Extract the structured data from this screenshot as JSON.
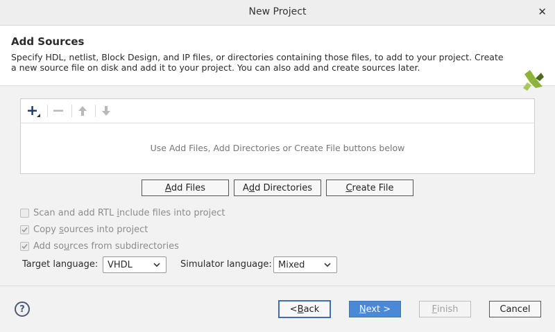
{
  "window": {
    "title": "New Project",
    "close_glyph": "✕"
  },
  "header": {
    "title": "Add Sources",
    "description": "Specify HDL, netlist, Block Design, and IP files, or directories containing those files, to add to your project. Create a new source file on disk and add it to your project. You can also add and create sources later.",
    "logo_icon": "xilinx-logo"
  },
  "toolbar": {
    "icons": [
      "plus-icon",
      "minus-icon",
      "arrow-up-icon",
      "arrow-down-icon"
    ]
  },
  "files_panel": {
    "empty_message": "Use Add Files, Add Directories or Create File buttons below"
  },
  "add_buttons": {
    "add_files": {
      "prefix": "",
      "mnemonic": "A",
      "rest": "dd Files"
    },
    "add_directories": {
      "prefix": "A",
      "mnemonic": "d",
      "rest": "d Directories"
    },
    "create_file": {
      "prefix": "",
      "mnemonic": "C",
      "rest": "reate File"
    }
  },
  "options": [
    {
      "prefix": "Scan and add RTL ",
      "mnemonic": "i",
      "rest": "nclude files into project",
      "checked": false,
      "enabled": false
    },
    {
      "prefix": "Copy ",
      "mnemonic": "s",
      "rest": "ources into project",
      "checked": true,
      "enabled": false
    },
    {
      "prefix": "Add so",
      "mnemonic": "u",
      "rest": "rces from subdirectories",
      "checked": true,
      "enabled": false
    }
  ],
  "target_language": {
    "label": "Target language:",
    "value": "VHDL"
  },
  "simulator_language": {
    "label": "Simulator language:",
    "value": "Mixed"
  },
  "footer": {
    "help_glyph": "?",
    "back": {
      "prefix": "< ",
      "mnemonic": "B",
      "rest": "ack"
    },
    "next": {
      "prefix": "",
      "mnemonic": "N",
      "rest": "ext >"
    },
    "finish": {
      "prefix": "",
      "mnemonic": "F",
      "rest": "inish"
    },
    "cancel": {
      "label": "Cancel"
    }
  },
  "colors": {
    "accent": "#4a88d8",
    "logo_green": "#8db33a",
    "logo_dark": "#4d6b1c"
  }
}
